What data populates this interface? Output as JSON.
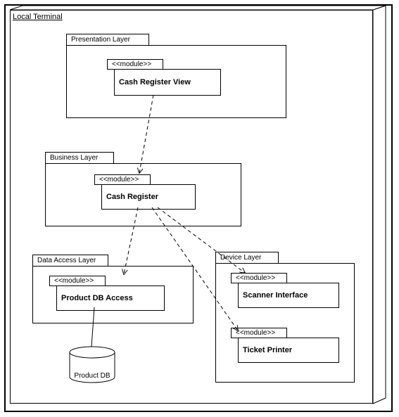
{
  "terminal_title": "Local Terminal",
  "presentation": {
    "layer_label": "Presentation Layer",
    "module_stereotype": "<<module>>",
    "module_name": "Cash Register View"
  },
  "business": {
    "layer_label": "Business Layer",
    "module_stereotype": "<<module>>",
    "module_name": "Cash Register"
  },
  "data_access": {
    "layer_label": "Data Access Layer",
    "module_stereotype": "<<module>>",
    "module_name": "Product DB Access"
  },
  "device": {
    "layer_label": "Device Layer",
    "scanner": {
      "stereotype": "<<module>>",
      "name": "Scanner Interface"
    },
    "printer": {
      "stereotype": "<<module>>",
      "name": "Ticket Printer"
    }
  },
  "database_label": "Product DB"
}
